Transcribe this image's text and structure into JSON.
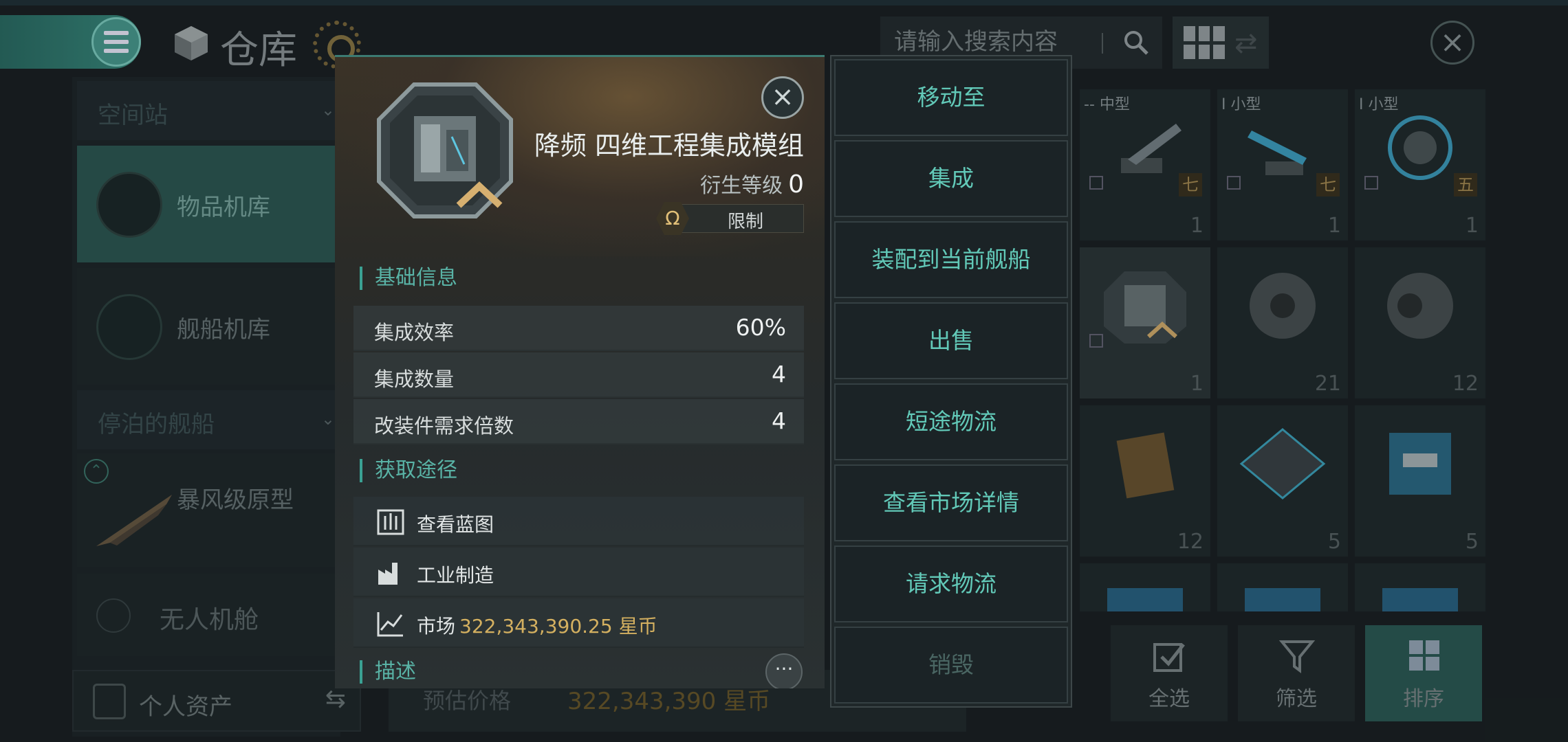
{
  "header": {
    "title": "仓库",
    "search_placeholder": "请输入搜索内容"
  },
  "sidebar": {
    "station_header": "空间站",
    "items": [
      {
        "label": "物品机库"
      },
      {
        "label": "舰船机库"
      }
    ],
    "docked_header": "停泊的舰船",
    "ship": {
      "label": "暴风级原型"
    },
    "drone_bay": {
      "label": "无人机舱"
    },
    "assets": {
      "label": "个人资产"
    }
  },
  "price_bar": {
    "label": "预估价格",
    "value": "322,343,390 星币"
  },
  "grid": {
    "cells": [
      {
        "tag": "-- 中型",
        "level": "七",
        "count": "1"
      },
      {
        "tag": "I 小型",
        "level": "七",
        "count": "1"
      },
      {
        "tag": "I 小型",
        "level": "五",
        "count": "1"
      },
      {
        "count": "1"
      },
      {
        "count": "21"
      },
      {
        "count": "12"
      },
      {
        "count": "12"
      },
      {
        "count": "5"
      },
      {
        "count": "5"
      }
    ]
  },
  "toolbar": {
    "select_all": "全选",
    "filter": "筛选",
    "sort": "排序"
  },
  "item": {
    "name": "降频 四维工程集成模组",
    "derivative_label": "衍生等级",
    "derivative_value": "0",
    "restriction": "限制",
    "basic_info_title": "基础信息",
    "stats": [
      {
        "label": "集成效率",
        "value": "60%"
      },
      {
        "label": "集成数量",
        "value": "4"
      },
      {
        "label": "改装件需求倍数",
        "value": "4"
      }
    ],
    "acquire_title": "获取途径",
    "sources": {
      "blueprint": "查看蓝图",
      "industry": "工业制造",
      "market_label": "市场",
      "market_price": "322,343,390.25 星币"
    },
    "description_title": "描述"
  },
  "actions": [
    {
      "label": "移动至"
    },
    {
      "label": "集成"
    },
    {
      "label": "装配到当前舰船"
    },
    {
      "label": "出售"
    },
    {
      "label": "短途物流"
    },
    {
      "label": "查看市场详情"
    },
    {
      "label": "请求物流"
    },
    {
      "label": "销毁"
    }
  ],
  "colors": {
    "accent": "#59b3a6",
    "action_text": "#62c9b8",
    "price_gold": "#d4b060",
    "background": "#1b2225"
  },
  "icons": [
    "menu-icon",
    "warehouse-cube-icon",
    "search-icon",
    "grid-view-icon",
    "swap-icon",
    "close-icon",
    "blueprint-icon",
    "factory-icon",
    "market-chart-icon",
    "omega-icon",
    "more-icon",
    "select-all-icon",
    "filter-icon",
    "sort-icon"
  ]
}
